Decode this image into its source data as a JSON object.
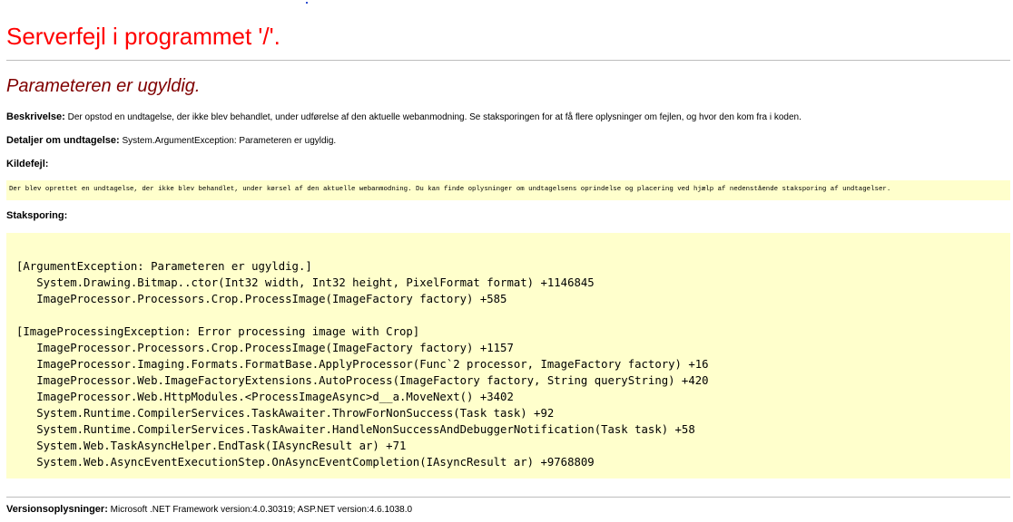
{
  "page": {
    "title": "Serverfejl i programmet '/'.",
    "subtitle": "Parameteren er ugyldig."
  },
  "description": {
    "label": "Beskrivelse:",
    "text": "Der opstod en undtagelse, der ikke blev behandlet, under udførelse af den aktuelle webanmodning. Se staksporingen for at få flere oplysninger om fejlen, og hvor den kom fra i koden."
  },
  "exception_details": {
    "label": "Detaljer om undtagelse:",
    "text": "System.ArgumentException: Parameteren er ugyldig."
  },
  "source_error": {
    "label": "Kildefejl:",
    "text": "Der blev oprettet en undtagelse, der ikke blev behandlet,  under kørsel af den aktuelle webanmodning. Du kan finde oplysninger om undtagelsens oprindelse og placering ved hjælp af nedenstående stakspor­ing af undtagelser."
  },
  "stack_trace": {
    "label": "Staksporing:",
    "lines": [
      "[ArgumentException: Parameteren er ugyldig.]",
      "   System.Drawing.Bitmap..ctor(Int32 width, Int32 height, PixelFormat format) +1146845",
      "   ImageProcessor.Processors.Crop.ProcessImage(ImageFactory factory) +585",
      "",
      "[ImageProcessingException: Error processing image with Crop]",
      "   ImageProcessor.Processors.Crop.ProcessImage(ImageFactory factory) +1157",
      "   ImageProcessor.Imaging.Formats.FormatBase.ApplyProcessor(Func`2 processor, ImageFactory factory) +16",
      "   ImageProcessor.Web.ImageFactoryExtensions.AutoProcess(ImageFactory factory, String queryString) +420",
      "   ImageProcessor.Web.HttpModules.<ProcessImageAsync>d__a.MoveNext() +3402",
      "   System.Runtime.CompilerServices.TaskAwaiter.ThrowForNonSuccess(Task task) +92",
      "   System.Runtime.CompilerServices.TaskAwaiter.HandleNonSuccessAndDebuggerNotification(Task task) +58",
      "   System.Web.TaskAsyncHelper.EndTask(IAsyncResult ar) +71",
      "   System.Web.AsyncEventExecutionStep.OnAsyncEventCompletion(IAsyncResult ar) +9768809"
    ]
  },
  "version_info": {
    "label": "Versionsoplysninger:",
    "text": "Microsoft .NET Framework version:4.0.30319; ASP.NET version:4.6.1038.0"
  }
}
